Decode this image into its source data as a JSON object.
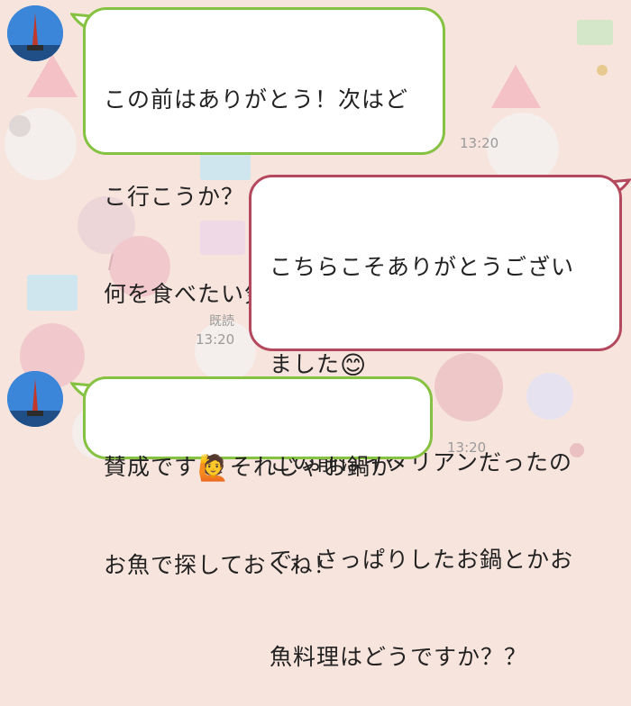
{
  "messages": [
    {
      "sender": "friend",
      "lines": [
        "この前はありがとう！次はど",
        "こ行こうか？",
        "何を食べたい気分かな〜？"
      ],
      "emoji": "🤔",
      "emoji_name": "thinking-face",
      "time": "13:20"
    },
    {
      "sender": "me",
      "line1": "こちらこそありがとうござい",
      "line2": "ました",
      "emoji": "😊",
      "emoji_name": "smiling-face",
      "lines_after": [
        "この前はイタリアンだったの",
        "で、さっぱりしたお鍋とかお",
        "魚料理はどうですか？？"
      ],
      "read_status": "既読",
      "time": "13:20"
    },
    {
      "sender": "friend",
      "line1_a": "賛成です",
      "emoji": "🙋",
      "emoji_name": "raising-hand-woman",
      "line1_b": "それじゃお鍋か",
      "line2": "お魚で探しておくね！",
      "time": "13:20"
    }
  ],
  "colors": {
    "friend_bubble_border": "#86c241",
    "my_bubble_border": "#b4485d",
    "background": "#f7e4dd"
  }
}
